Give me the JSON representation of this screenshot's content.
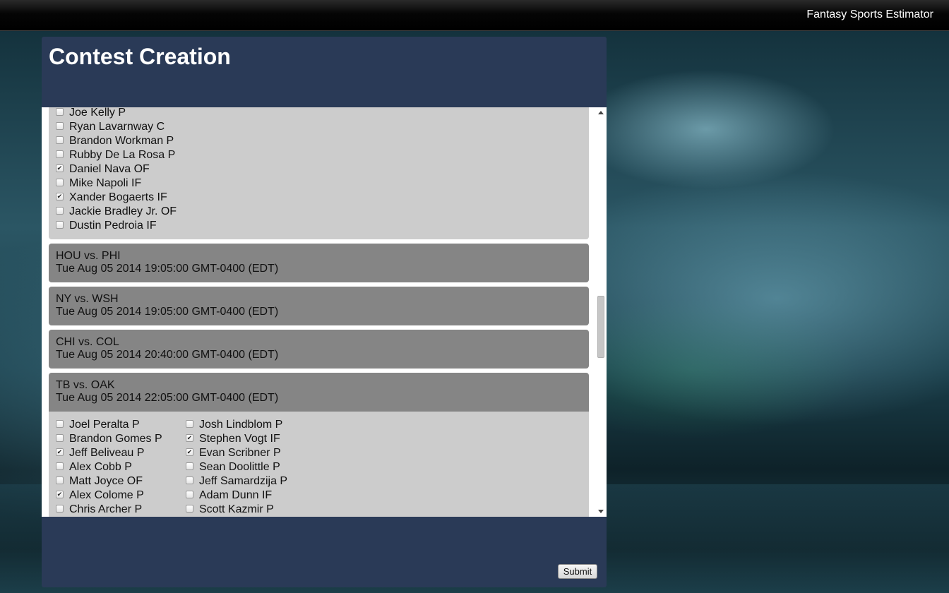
{
  "app": {
    "title": "Fantasy Sports Estimator"
  },
  "page": {
    "title": "Contest Creation"
  },
  "section1": {
    "players": [
      {
        "name": "Joe Kelly P",
        "checked": false
      },
      {
        "name": "Ryan Lavarnway C",
        "checked": false
      },
      {
        "name": "Brandon Workman P",
        "checked": false
      },
      {
        "name": "Rubby De La Rosa P",
        "checked": false
      },
      {
        "name": "Daniel Nava OF",
        "checked": true
      },
      {
        "name": "Mike Napoli IF",
        "checked": false
      },
      {
        "name": "Xander Bogaerts IF",
        "checked": true
      },
      {
        "name": "Jackie Bradley Jr. OF",
        "checked": false
      },
      {
        "name": "Dustin Pedroia IF",
        "checked": false
      }
    ]
  },
  "games": [
    {
      "matchup": "HOU vs. PHI",
      "time": "Tue Aug 05 2014 19:05:00 GMT-0400 (EDT)"
    },
    {
      "matchup": "NY vs. WSH",
      "time": "Tue Aug 05 2014 19:05:00 GMT-0400 (EDT)"
    },
    {
      "matchup": "CHI vs. COL",
      "time": "Tue Aug 05 2014 20:40:00 GMT-0400 (EDT)"
    },
    {
      "matchup": "TB vs. OAK",
      "time": "Tue Aug 05 2014 22:05:00 GMT-0400 (EDT)"
    }
  ],
  "tb_oak": {
    "left": [
      {
        "name": "Joel Peralta P",
        "checked": false
      },
      {
        "name": "Brandon Gomes P",
        "checked": false
      },
      {
        "name": "Jeff Beliveau P",
        "checked": true
      },
      {
        "name": "Alex Cobb P",
        "checked": false
      },
      {
        "name": "Matt Joyce OF",
        "checked": false
      },
      {
        "name": "Alex Colome P",
        "checked": true
      },
      {
        "name": "Chris Archer P",
        "checked": false
      }
    ],
    "right": [
      {
        "name": "Josh Lindblom P",
        "checked": false
      },
      {
        "name": "Stephen Vogt IF",
        "checked": true
      },
      {
        "name": "Evan Scribner P",
        "checked": true
      },
      {
        "name": "Sean Doolittle P",
        "checked": false
      },
      {
        "name": "Jeff Samardzija P",
        "checked": false
      },
      {
        "name": "Adam Dunn IF",
        "checked": false
      },
      {
        "name": "Scott Kazmir P",
        "checked": false
      }
    ]
  },
  "form": {
    "submit_label": "Submit"
  },
  "colors": {
    "panel": "#2a3a57",
    "game_header": "#858585",
    "player_box": "#cccccc"
  }
}
